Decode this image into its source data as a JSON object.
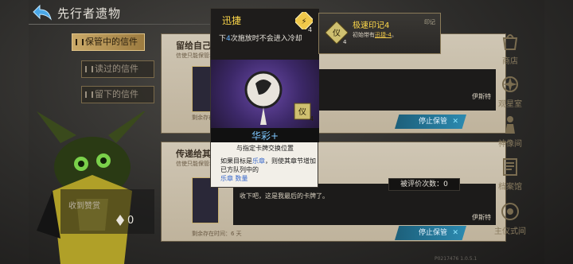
{
  "header": {
    "title": "先行者遗物"
  },
  "tabs": [
    {
      "label": "保管中的信件",
      "active": true
    },
    {
      "label": "读过的信件",
      "active": false
    },
    {
      "label": "留下的信件",
      "active": false
    }
  ],
  "receive": {
    "label": "收到赞赏",
    "count": "0"
  },
  "letters": [
    {
      "title": "留给自己的",
      "subtitle": "信使只能保管着",
      "message": "",
      "signature": "伊斯特",
      "remaining": "剩余存在时",
      "stop_label": "停止保管"
    },
    {
      "title": "传递给其",
      "subtitle": "信使只能保管着",
      "message": "收下吧，这是我最后的卡牌了。",
      "signature": "伊斯特",
      "remaining": "剩余存在时间：6 天",
      "stop_label": "停止保管"
    }
  ],
  "card_tooltip": {
    "title": "迅捷",
    "desc_prefix": "下",
    "desc_number": "4",
    "desc_suffix": "次施放时不会进入冷却",
    "cost_top": "4",
    "cost_bottom": "4",
    "name": "华彩+",
    "line1": "与指定卡牌交换位置",
    "line2_a": "如果目标是",
    "line2_hl": "乐章",
    "line2_b": "，则使其章节增加已方队列中的",
    "line2_c": "乐章 数量"
  },
  "mark_popup": {
    "title": "极速印记4",
    "tag": "印记",
    "desc_prefix": "初始带有",
    "desc_link": "迅捷-4",
    "desc_suffix": "。",
    "badge": "4"
  },
  "rating": {
    "label": "被评价次数：",
    "value": "0"
  },
  "nav": [
    {
      "label": "商店",
      "icon": "shop-icon"
    },
    {
      "label": "观星室",
      "icon": "observatory-icon"
    },
    {
      "label": "神像间",
      "icon": "statue-icon"
    },
    {
      "label": "档案馆",
      "icon": "archive-icon"
    },
    {
      "label": "主仪式间",
      "icon": "ritual-icon"
    }
  ],
  "version": "P0217476 1.0.5.1",
  "colors": {
    "accent_gold": "#caa968",
    "stop_button": "#2c8ab0",
    "highlight_yellow": "#ffd94a",
    "link_blue": "#6ab4ff"
  }
}
